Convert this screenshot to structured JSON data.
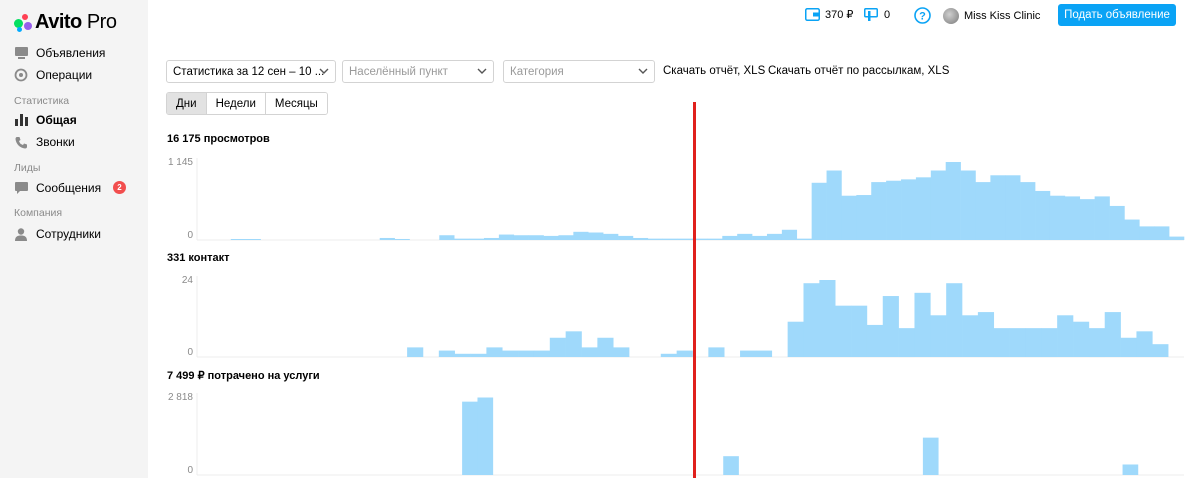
{
  "sidebar": {
    "logo_main": "Avito",
    "logo_pro": "Pro",
    "items": [
      {
        "label": "Объявления",
        "icon": "ads-icon"
      },
      {
        "label": "Операции",
        "icon": "operations-icon"
      },
      {
        "section": "Статистика"
      },
      {
        "label": "Общая",
        "icon": "bar-chart-icon",
        "active": true
      },
      {
        "label": "Звонки",
        "icon": "phone-icon"
      },
      {
        "section": "Лиды"
      },
      {
        "label": "Сообщения",
        "icon": "chat-icon",
        "badge": "2"
      },
      {
        "section": "Компания"
      },
      {
        "label": "Сотрудники",
        "icon": "user-icon"
      }
    ]
  },
  "header": {
    "wallet": "370 ₽",
    "bonus": "0",
    "user_name": "Miss Kiss Clinic",
    "post_button": "Подать объявление"
  },
  "filters": {
    "period": "Статистика за 12 сен – 10 ...",
    "city_placeholder": "Населённый пункт",
    "category_placeholder": "Категория",
    "download_report": "Скачать отчёт, XLS",
    "download_mailing_report": "Скачать отчёт по рассылкам, XLS"
  },
  "tabs": [
    {
      "label": "Дни",
      "active": true
    },
    {
      "label": "Недели",
      "active": false
    },
    {
      "label": "Месяцы",
      "active": false
    }
  ],
  "colors": {
    "bar": "#9fd9fb",
    "accent": "#0aa3f5",
    "marker": "#e0201c"
  },
  "chart_data": [
    {
      "type": "bar",
      "title": "16 175 просмотров",
      "ylim": [
        0,
        1145
      ],
      "yticks": [
        "1 145",
        "0"
      ],
      "values": [
        0,
        0,
        3,
        3,
        0,
        0,
        0,
        0,
        0,
        0,
        0,
        0,
        30,
        15,
        0,
        0,
        70,
        20,
        20,
        30,
        80,
        70,
        70,
        60,
        70,
        120,
        110,
        90,
        60,
        30,
        20,
        20,
        20,
        20,
        20,
        60,
        90,
        60,
        90,
        150,
        20,
        840,
        1020,
        650,
        660,
        850,
        870,
        890,
        920,
        1020,
        1145,
        1020,
        850,
        950,
        950,
        850,
        720,
        650,
        640,
        600,
        640,
        500,
        300,
        200,
        200,
        50
      ]
    },
    {
      "type": "bar",
      "title": "331 контакт",
      "ylim": [
        0,
        24
      ],
      "yticks": [
        "24",
        "0"
      ],
      "values": [
        0,
        0,
        0,
        0,
        0,
        0,
        0,
        0,
        0,
        0,
        0,
        0,
        0,
        3,
        0,
        2,
        1,
        1,
        3,
        2,
        2,
        2,
        6,
        8,
        3,
        6,
        3,
        0,
        0,
        1,
        2,
        0,
        3,
        0,
        2,
        2,
        0,
        11,
        23,
        24,
        16,
        16,
        10,
        19,
        9,
        20,
        13,
        23,
        13,
        14,
        9,
        9,
        9,
        9,
        13,
        11,
        9,
        14,
        6,
        8,
        4,
        0
      ]
    },
    {
      "type": "bar",
      "title": "7 499 ₽ потрачено на услуги",
      "ylim": [
        0,
        2818
      ],
      "yticks": [
        "2 818",
        "0"
      ],
      "values": [
        0,
        0,
        0,
        0,
        0,
        0,
        0,
        0,
        0,
        0,
        0,
        0,
        0,
        0,
        0,
        0,
        0,
        2650,
        2800,
        0,
        0,
        0,
        0,
        0,
        0,
        0,
        0,
        0,
        0,
        0,
        0,
        0,
        0,
        0,
        680,
        0,
        0,
        0,
        0,
        0,
        0,
        0,
        0,
        0,
        0,
        0,
        0,
        1350,
        0,
        0,
        0,
        0,
        0,
        0,
        0,
        0,
        0,
        0,
        0,
        0,
        380,
        0,
        0,
        0
      ]
    }
  ]
}
